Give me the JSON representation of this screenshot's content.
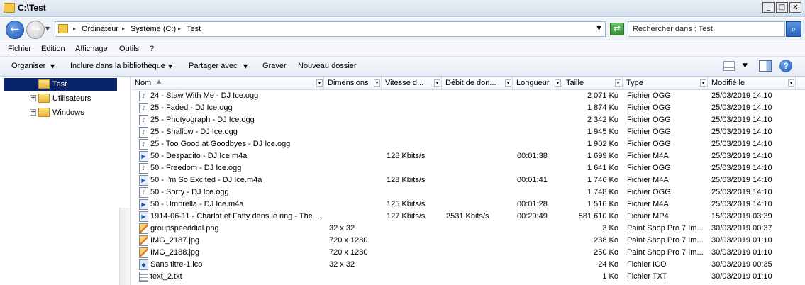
{
  "window": {
    "title": "C:\\Test",
    "minimize": "_",
    "maximize": "□",
    "close": "✕"
  },
  "address": {
    "crumbs": [
      "Ordinateur",
      "Système (C:)",
      "Test"
    ],
    "search_placeholder": "Rechercher dans : Test"
  },
  "menu": [
    "Fichier",
    "Edition",
    "Affichage",
    "Outils",
    "?"
  ],
  "commands": {
    "organize": "Organiser",
    "include": "Inclure dans la bibliothèque",
    "share": "Partager avec",
    "burn": "Graver",
    "new_folder": "Nouveau dossier"
  },
  "icons": {
    "back": "back-arrow-icon",
    "forward": "forward-arrow-icon",
    "refresh": "refresh-icon",
    "search": "search-icon",
    "view": "view-details-icon",
    "pane": "preview-pane-icon",
    "help": "help-icon"
  },
  "tree": [
    {
      "label": "Test",
      "selected": true
    },
    {
      "label": "Utilisateurs",
      "expander": "+"
    },
    {
      "label": "Windows",
      "expander": "+"
    }
  ],
  "columns": {
    "name": "Nom",
    "dimensions": "Dimensions",
    "speed": "Vitesse d...",
    "bitrate": "Débit de don...",
    "length": "Longueur",
    "size": "Taille",
    "type": "Type",
    "modified": "Modifié le"
  },
  "files": [
    {
      "icon": "ogg",
      "name": "24 - Staw With Me - DJ Ice.ogg",
      "dimensions": "",
      "speed": "",
      "bitrate": "",
      "length": "",
      "size": "2 071 Ko",
      "type": "Fichier OGG",
      "modified": "25/03/2019 14:10"
    },
    {
      "icon": "ogg",
      "name": "25 - Faded - DJ Ice.ogg",
      "dimensions": "",
      "speed": "",
      "bitrate": "",
      "length": "",
      "size": "1 874 Ko",
      "type": "Fichier OGG",
      "modified": "25/03/2019 14:10"
    },
    {
      "icon": "ogg",
      "name": "25 - Photyograph - DJ Ice.ogg",
      "dimensions": "",
      "speed": "",
      "bitrate": "",
      "length": "",
      "size": "2 342 Ko",
      "type": "Fichier OGG",
      "modified": "25/03/2019 14:10"
    },
    {
      "icon": "ogg",
      "name": "25 - Shallow - DJ Ice.ogg",
      "dimensions": "",
      "speed": "",
      "bitrate": "",
      "length": "",
      "size": "1 945 Ko",
      "type": "Fichier OGG",
      "modified": "25/03/2019 14:10"
    },
    {
      "icon": "ogg",
      "name": "25 - Too Good at Goodbyes - DJ Ice.ogg",
      "dimensions": "",
      "speed": "",
      "bitrate": "",
      "length": "",
      "size": "1 902 Ko",
      "type": "Fichier OGG",
      "modified": "25/03/2019 14:10"
    },
    {
      "icon": "media",
      "name": "50 - Despacito - DJ Ice.m4a",
      "dimensions": "",
      "speed": "128 Kbits/s",
      "bitrate": "",
      "length": "00:01:38",
      "size": "1 699 Ko",
      "type": "Fichier M4A",
      "modified": "25/03/2019 14:10"
    },
    {
      "icon": "ogg",
      "name": "50 - Freedom - DJ Ice.ogg",
      "dimensions": "",
      "speed": "",
      "bitrate": "",
      "length": "",
      "size": "1 641 Ko",
      "type": "Fichier OGG",
      "modified": "25/03/2019 14:10"
    },
    {
      "icon": "media",
      "name": "50 - I'm So Excited - DJ Ice.m4a",
      "dimensions": "",
      "speed": "128 Kbits/s",
      "bitrate": "",
      "length": "00:01:41",
      "size": "1 746 Ko",
      "type": "Fichier M4A",
      "modified": "25/03/2019 14:10"
    },
    {
      "icon": "ogg",
      "name": "50 - Sorry - DJ Ice.ogg",
      "dimensions": "",
      "speed": "",
      "bitrate": "",
      "length": "",
      "size": "1 748 Ko",
      "type": "Fichier OGG",
      "modified": "25/03/2019 14:10"
    },
    {
      "icon": "media",
      "name": "50 - Umbrella - DJ Ice.m4a",
      "dimensions": "",
      "speed": "125 Kbits/s",
      "bitrate": "",
      "length": "00:01:28",
      "size": "1 516 Ko",
      "type": "Fichier M4A",
      "modified": "25/03/2019 14:10"
    },
    {
      "icon": "media",
      "name": "1914-06-11 - Charlot et Fatty dans le ring - The ...",
      "dimensions": "",
      "speed": "127 Kbits/s",
      "bitrate": "2531 Kbits/s",
      "length": "00:29:49",
      "size": "581 610 Ko",
      "type": "Fichier MP4",
      "modified": "15/03/2019 03:39"
    },
    {
      "icon": "image",
      "name": "groupspeeddial.png",
      "dimensions": "32 x 32",
      "speed": "",
      "bitrate": "",
      "length": "",
      "size": "3 Ko",
      "type": "Paint Shop Pro 7 Im...",
      "modified": "30/03/2019 00:37"
    },
    {
      "icon": "image",
      "name": "IMG_2187.jpg",
      "dimensions": "720 x 1280",
      "speed": "",
      "bitrate": "",
      "length": "",
      "size": "238 Ko",
      "type": "Paint Shop Pro 7 Im...",
      "modified": "30/03/2019 01:10"
    },
    {
      "icon": "image",
      "name": "IMG_2188.jpg",
      "dimensions": "720 x 1280",
      "speed": "",
      "bitrate": "",
      "length": "",
      "size": "250 Ko",
      "type": "Paint Shop Pro 7 Im...",
      "modified": "30/03/2019 01:10"
    },
    {
      "icon": "ico",
      "name": "Sans titre-1.ico",
      "dimensions": "32 x 32",
      "speed": "",
      "bitrate": "",
      "length": "",
      "size": "24 Ko",
      "type": "Fichier ICO",
      "modified": "30/03/2019 00:35"
    },
    {
      "icon": "txt",
      "name": "text_2.txt",
      "dimensions": "",
      "speed": "",
      "bitrate": "",
      "length": "",
      "size": "1 Ko",
      "type": "Fichier TXT",
      "modified": "30/03/2019 01:10"
    }
  ]
}
